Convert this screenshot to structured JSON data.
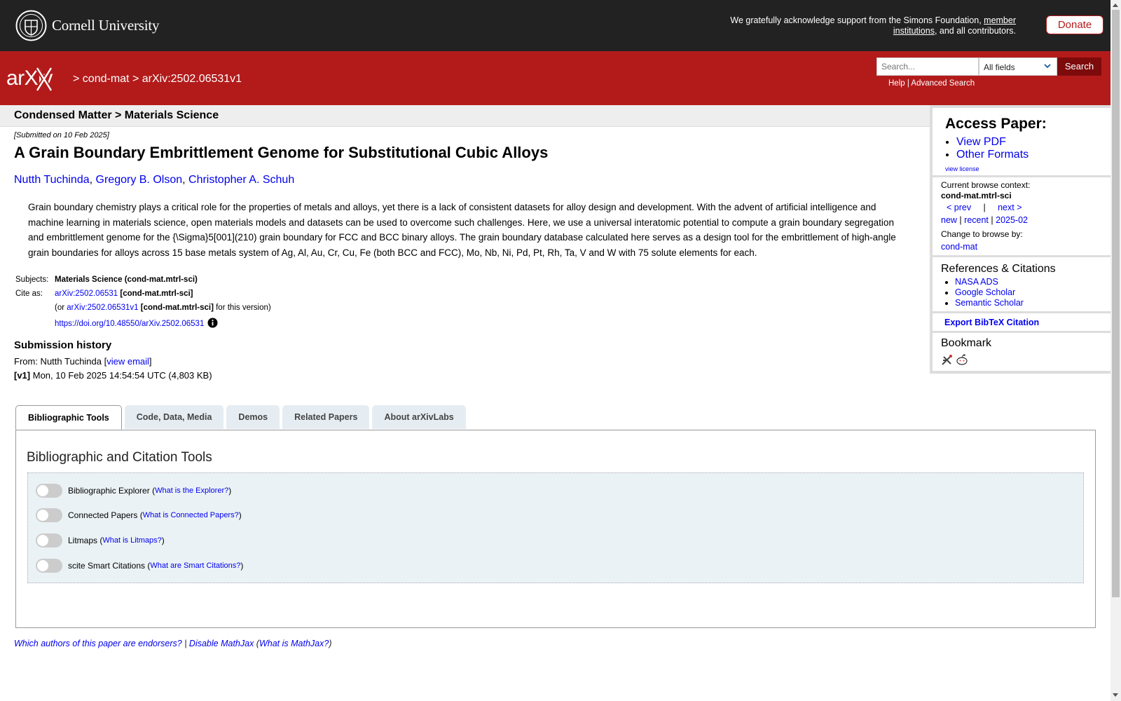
{
  "cornell": {
    "name": "Cornell University"
  },
  "ack": {
    "text": "We gratefully acknowledge support from the Simons Foundation, ",
    "link": "member institutions",
    "tail": ", and all contributors."
  },
  "donate": "Donate",
  "brand": {
    "logo_text": "arXiv"
  },
  "breadcrumb": {
    "sep1": ">",
    "category": "cond-mat",
    "sep2": ">",
    "paper_id": "arXiv:2502.06531v1"
  },
  "search": {
    "placeholder": "Search...",
    "field": "All fields",
    "button": "Search",
    "help": "Help",
    "separator": "|",
    "advanced": "Advanced Search"
  },
  "subheader": "Condensed Matter > Materials Science",
  "paper": {
    "submitted": "[Submitted on 10 Feb 2025]",
    "title": "A Grain Boundary Embrittlement Genome for Substitutional Cubic Alloys",
    "authors": [
      "Nutth Tuchinda",
      "Gregory B. Olson",
      "Christopher A. Schuh"
    ],
    "abstract": "Grain boundary chemistry plays a critical role for the properties of metals and alloys, yet there is a lack of consistent datasets for alloy design and development. With the advent of artificial intelligence and machine learning in materials science, open materials models and datasets can be used to overcome such challenges. Here, we use a universal interatomic potential to compute a grain boundary segregation and embrittlement genome for the {\\Sigma}5[001](210) grain boundary for FCC and BCC binary alloys. The grain boundary database calculated here serves as a design tool for the embrittlement of high-angle grain boundaries for alloys across 15 base metals system of Ag, Al, Au, Cr, Cu, Fe (both BCC and FCC), Mo, Nb, Ni, Pd, Pt, Rh, Ta, V and W with 75 solute elements for each."
  },
  "meta": {
    "subjects_label": "Subjects:",
    "subjects": "Materials Science (cond-mat.mtrl-sci)",
    "cite_label": "Cite as:",
    "cite_id": "arXiv:2502.06531",
    "cite_cat": "[cond-mat.mtrl-sci]",
    "version_prefix": "(or ",
    "version_id": "arXiv:2502.06531v1",
    "version_cat": "[cond-mat.mtrl-sci]",
    "version_suffix": " for this version)",
    "doi": "https://doi.org/10.48550/arXiv.2502.06531"
  },
  "history": {
    "title": "Submission history",
    "from_prefix": "From: Nutth Tuchinda [",
    "from_link": "view email",
    "from_suffix": "]",
    "v1_label": "[v1]",
    "v1_text": " Mon, 10 Feb 2025 14:54:54 UTC (4,803 KB)"
  },
  "tabs": [
    "Bibliographic Tools",
    "Code, Data, Media",
    "Demos",
    "Related Papers",
    "About arXivLabs"
  ],
  "panel": {
    "title": "Bibliographic and Citation Tools",
    "toggles": [
      {
        "label": "Bibliographic Explorer",
        "help": "What is the Explorer?"
      },
      {
        "label": "Connected Papers",
        "help": "What is Connected Papers?"
      },
      {
        "label": "Litmaps",
        "help": "What is Litmaps?"
      },
      {
        "label": "scite Smart Citations",
        "help": "What are Smart Citations?"
      }
    ]
  },
  "footer": {
    "endorsers": "Which authors of this paper are endorsers?",
    "sep": " | ",
    "mathjax": "Disable MathJax",
    "what_mathjax": "What is MathJax?"
  },
  "sidebar": {
    "access_title": "Access Paper:",
    "access_links": [
      "View PDF",
      "Other Formats"
    ],
    "license": "view license",
    "context_label": "Current browse context:",
    "context_value": "cond-mat.mtrl-sci",
    "prev": "< prev",
    "pipe": "|",
    "next": "next >",
    "new": "new",
    "recent": "recent",
    "month": "2025-02",
    "change_label": "Change to browse by:",
    "change_value": "cond-mat",
    "refs_title": "References & Citations",
    "refs": [
      "NASA ADS",
      "Google Scholar",
      "Semantic Scholar"
    ],
    "export": "Export BibTeX Citation",
    "bookmark_title": "Bookmark"
  },
  "colors": {
    "arxiv_red": "#b31b1b",
    "topbar": "#222222",
    "link": "#0000ee"
  }
}
